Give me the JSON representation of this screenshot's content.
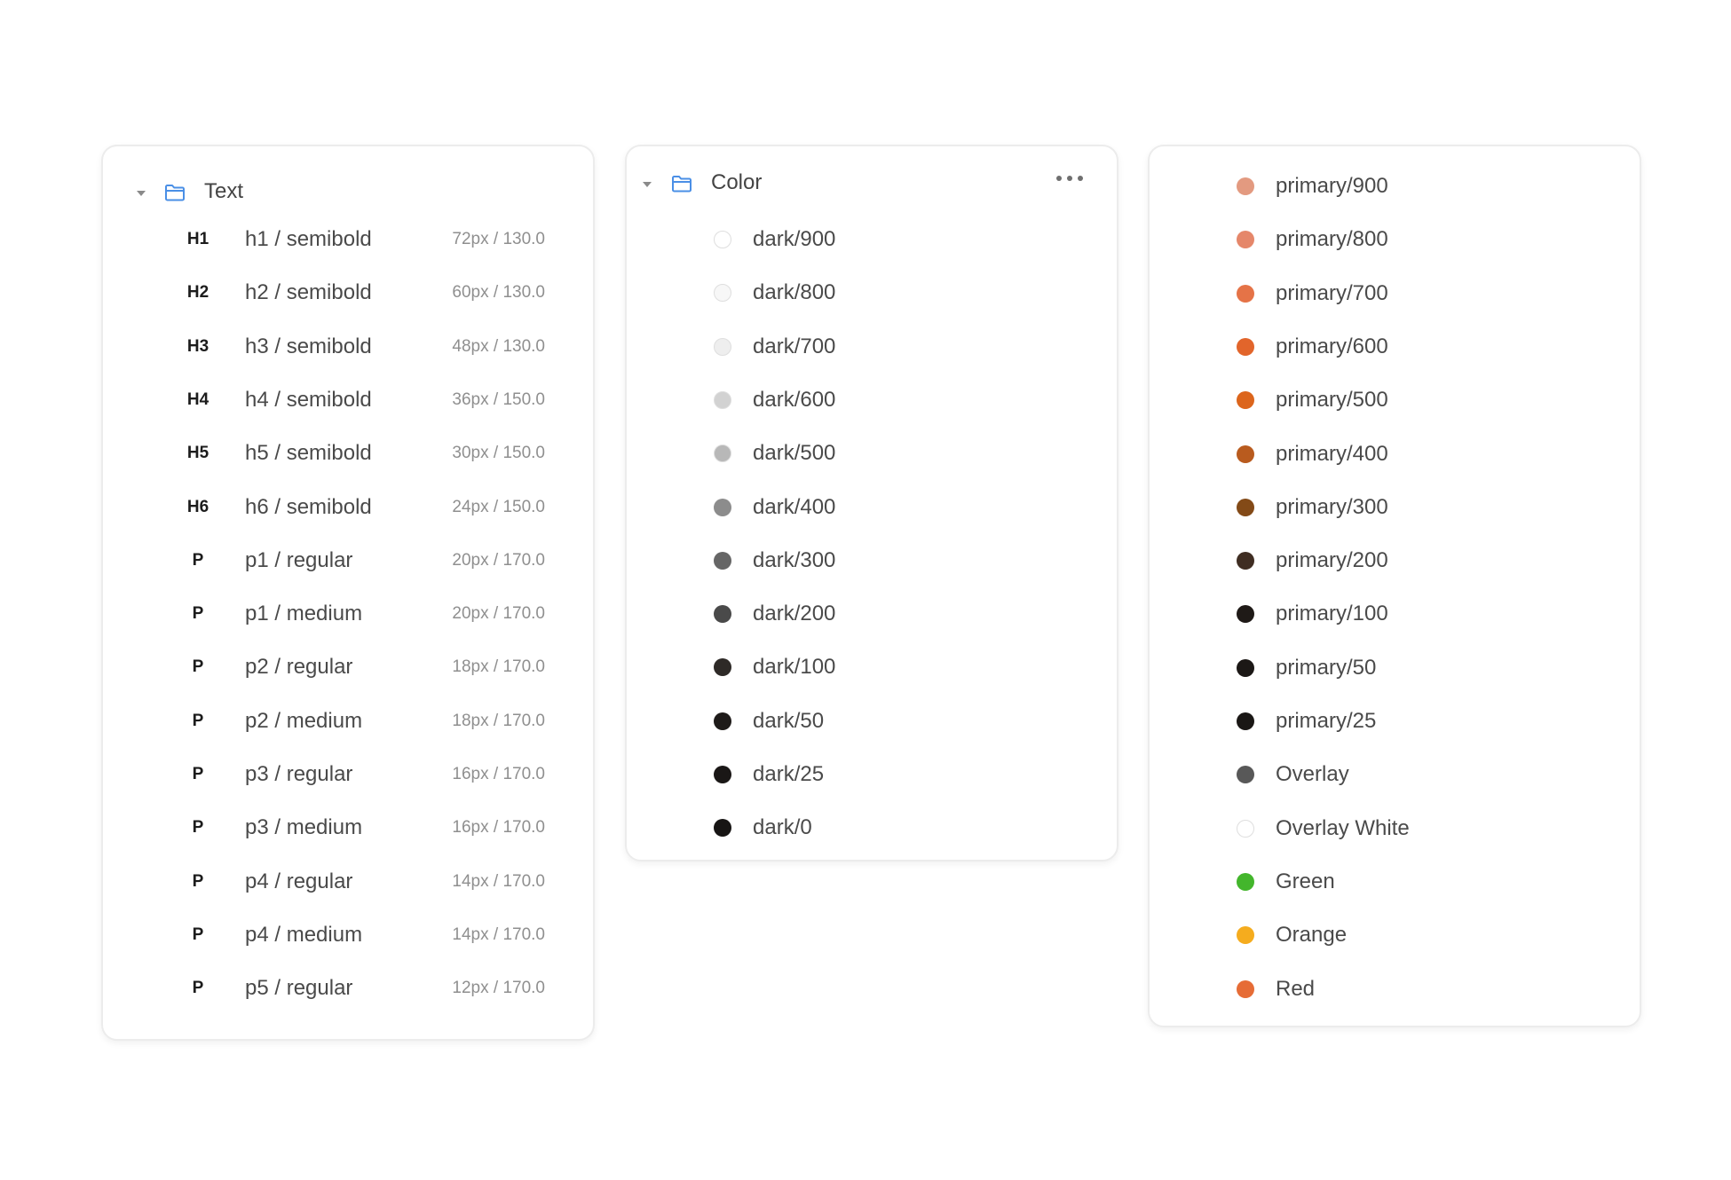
{
  "colors": {
    "folder": "#4a8fe6",
    "tag": "#1c1c1c",
    "name": "#4a4a4a",
    "meta": "#8f8f8f",
    "border": "#ececec"
  },
  "text_group": {
    "title": "Text",
    "icon": "folder-icon",
    "styles": [
      {
        "tag": "H1",
        "name": "h1 / semibold",
        "meta": "72px / 130.0"
      },
      {
        "tag": "H2",
        "name": "h2 / semibold",
        "meta": "60px / 130.0"
      },
      {
        "tag": "H3",
        "name": "h3 / semibold",
        "meta": "48px / 130.0"
      },
      {
        "tag": "H4",
        "name": "h4 / semibold",
        "meta": "36px / 150.0"
      },
      {
        "tag": "H5",
        "name": "h5 / semibold",
        "meta": "30px / 150.0"
      },
      {
        "tag": "H6",
        "name": "h6 / semibold",
        "meta": "24px / 150.0"
      },
      {
        "tag": "P",
        "name": "p1 / regular",
        "meta": "20px / 170.0"
      },
      {
        "tag": "P",
        "name": "p1 / medium",
        "meta": "20px / 170.0"
      },
      {
        "tag": "P",
        "name": "p2 / regular",
        "meta": "18px / 170.0"
      },
      {
        "tag": "P",
        "name": "p2 / medium",
        "meta": "18px / 170.0"
      },
      {
        "tag": "P",
        "name": "p3 / regular",
        "meta": "16px / 170.0"
      },
      {
        "tag": "P",
        "name": "p3 / medium",
        "meta": "16px / 170.0"
      },
      {
        "tag": "P",
        "name": "p4 / regular",
        "meta": "14px / 170.0"
      },
      {
        "tag": "P",
        "name": "p4 / medium",
        "meta": "14px / 170.0"
      },
      {
        "tag": "P",
        "name": "p5 / regular",
        "meta": "12px / 170.0"
      }
    ]
  },
  "color_group": {
    "title": "Color",
    "icon": "folder-icon",
    "more_icon": "more-horizontal-icon",
    "swatches": [
      {
        "name": "dark/900",
        "color": "#ffffff",
        "outline": true
      },
      {
        "name": "dark/800",
        "color": "#f7f7f7",
        "outline": true
      },
      {
        "name": "dark/700",
        "color": "#eeeeee",
        "outline": true
      },
      {
        "name": "dark/600",
        "color": "#d2d2d2",
        "outline": true
      },
      {
        "name": "dark/500",
        "color": "#b8b8b8",
        "outline": true
      },
      {
        "name": "dark/400",
        "color": "#8c8c8c",
        "outline": false
      },
      {
        "name": "dark/300",
        "color": "#666666",
        "outline": false
      },
      {
        "name": "dark/200",
        "color": "#4a4a4a",
        "outline": false
      },
      {
        "name": "dark/100",
        "color": "#2e2a27",
        "outline": false
      },
      {
        "name": "dark/50",
        "color": "#1e1b19",
        "outline": false
      },
      {
        "name": "dark/25",
        "color": "#1a1716",
        "outline": false
      },
      {
        "name": "dark/0",
        "color": "#171514",
        "outline": false
      }
    ]
  },
  "primary_group": {
    "swatches": [
      {
        "name": "primary/900",
        "color": "#e39a80",
        "outline": false
      },
      {
        "name": "primary/800",
        "color": "#e5876a",
        "outline": false
      },
      {
        "name": "primary/700",
        "color": "#e57347",
        "outline": false
      },
      {
        "name": "primary/600",
        "color": "#e2652b",
        "outline": false
      },
      {
        "name": "primary/500",
        "color": "#dc651c",
        "outline": false
      },
      {
        "name": "primary/400",
        "color": "#b95b1e",
        "outline": false
      },
      {
        "name": "primary/300",
        "color": "#834a17",
        "outline": false
      },
      {
        "name": "primary/200",
        "color": "#3f2d22",
        "outline": false
      },
      {
        "name": "primary/100",
        "color": "#1f1a17",
        "outline": false
      },
      {
        "name": "primary/50",
        "color": "#1c1816",
        "outline": false
      },
      {
        "name": "primary/25",
        "color": "#1a1715",
        "outline": false
      },
      {
        "name": "Overlay",
        "color": "#585858",
        "outline": false
      },
      {
        "name": "Overlay White",
        "color": "#ffffff",
        "outline": true
      },
      {
        "name": "Green",
        "color": "#43b62c",
        "outline": false
      },
      {
        "name": "Orange",
        "color": "#f5ac1e",
        "outline": false
      },
      {
        "name": "Red",
        "color": "#e66c36",
        "outline": false
      }
    ]
  }
}
